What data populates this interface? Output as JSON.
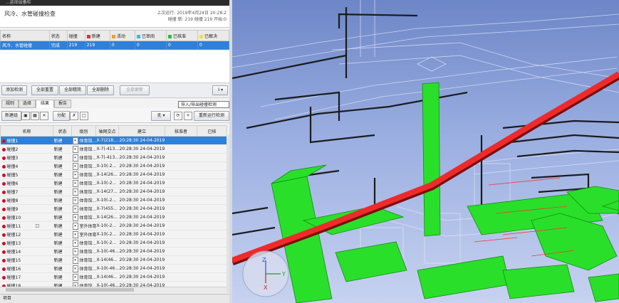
{
  "window": {
    "title": "...运动设备栏"
  },
  "header": {
    "name": "风冷、水管碰撞检查",
    "meta_line1": "上次运行: 2019年4月24日 20:28:2",
    "meta_line2": "碰撞   新: 219  碰撞 219  开始:0"
  },
  "summary": {
    "columns": [
      "名称",
      "状态",
      "碰撞",
      "新建",
      "活动",
      "已审阅",
      "已核准",
      "已解决"
    ],
    "column_colors": [
      "",
      "",
      "",
      "#e03030",
      "#f0a020",
      "#33bde0",
      "#2fbf2f",
      "#f0e040"
    ],
    "row": [
      "风冷、水管碰撞",
      "完成",
      "219",
      "219",
      "0",
      "0",
      "0",
      "0"
    ]
  },
  "toolbar1": {
    "add_test": "添加检测",
    "reset_all": "全部重置",
    "compact_all": "全部精简",
    "delete_all": "全部删除",
    "update_all": "全部更新"
  },
  "tooltip": "导入/导出碰撞检测",
  "tabs": [
    "规则",
    "选择",
    "结果",
    "报告"
  ],
  "toolbar2": {
    "new_group": "新建组",
    "assign": "分配",
    "none_label": "无",
    "rerun": "重新运行检测"
  },
  "grid": {
    "columns": [
      "名称",
      "",
      "状态",
      "级别",
      "轴网交点",
      "建立",
      "核准者",
      "已核"
    ],
    "rows": [
      {
        "name": "碰撞1",
        "status": "新建",
        "level": "体育馆...",
        "grid": "X-7(218....",
        "created": "20:28:30 24-04-2019"
      },
      {
        "name": "碰撞2",
        "status": "新建",
        "level": "体育馆...",
        "grid": "X-7(-413...",
        "created": "20:28:30 24-04-2019"
      },
      {
        "name": "碰撞3",
        "status": "新建",
        "level": "体育馆...",
        "grid": "X-7(-413...",
        "created": "20:28:30 24-04-2019"
      },
      {
        "name": "碰撞4",
        "status": "新建",
        "level": "体育馆...",
        "grid": "X-10(-2...",
        "created": "20:28:30 24-04-2019"
      },
      {
        "name": "碰撞5",
        "status": "新建",
        "level": "体育馆...",
        "grid": "X-14(26...",
        "created": "20:28:30 24-04-2019"
      },
      {
        "name": "碰撞6",
        "status": "新建",
        "level": "体育馆...",
        "grid": "X-10(-2...",
        "created": "20:28:30 24-04-2019"
      },
      {
        "name": "碰撞7",
        "status": "新建",
        "level": "体育馆...",
        "grid": "X-14(27...",
        "created": "20:28:30 24-04-2019"
      },
      {
        "name": "碰撞8",
        "status": "新建",
        "level": "体育馆...",
        "grid": "X-10(-2...",
        "created": "20:28:30 24-04-2019"
      },
      {
        "name": "碰撞9",
        "status": "新建",
        "level": "体育馆...",
        "grid": "X-7(455...",
        "created": "20:28:30 24-04-2019"
      },
      {
        "name": "碰撞10",
        "status": "新建",
        "level": "体育馆...",
        "grid": "X-14(26...",
        "created": "20:28:30 24-04-2019"
      },
      {
        "name": "碰撞11",
        "status": "新建",
        "level": "室外体育...",
        "grid": "X-10(-2...",
        "created": "20:28:30 24-04-2019"
      },
      {
        "name": "碰撞12",
        "status": "新建",
        "level": "室外体育...",
        "grid": "X-10(-2...",
        "created": "20:28:30 24-04-2019"
      },
      {
        "name": "碰撞13",
        "status": "新建",
        "level": "体育馆...",
        "grid": "X-10(-2...",
        "created": "20:28:30 24-04-2019"
      },
      {
        "name": "碰撞14",
        "status": "新建",
        "level": "体育馆...",
        "grid": "X-10(-46...",
        "created": "20:28:30 24-04-2019"
      },
      {
        "name": "碰撞15",
        "status": "新建",
        "level": "体育馆...",
        "grid": "X-14(46...",
        "created": "20:28:30 24-04-2019"
      },
      {
        "name": "碰撞16",
        "status": "新建",
        "level": "体育馆...",
        "grid": "X-10(-46...",
        "created": "20:28:30 24-04-2019"
      },
      {
        "name": "碰撞17",
        "status": "新建",
        "level": "体育馆...",
        "grid": "X-14(46...",
        "created": "20:28:30 24-04-2019"
      },
      {
        "name": "碰撞18",
        "status": "新建",
        "level": "体育馆...",
        "grid": "X-10(-46...",
        "created": "20:28:30 24-04-2019"
      }
    ]
  },
  "status_bar": {
    "label": "项目"
  },
  "viewcube": {
    "x": "X",
    "y": "Y",
    "z": "Z"
  },
  "colors": {
    "clash_red": "#e02020",
    "clash_green": "#22dd22",
    "selection_blue": "#2f80d8"
  }
}
